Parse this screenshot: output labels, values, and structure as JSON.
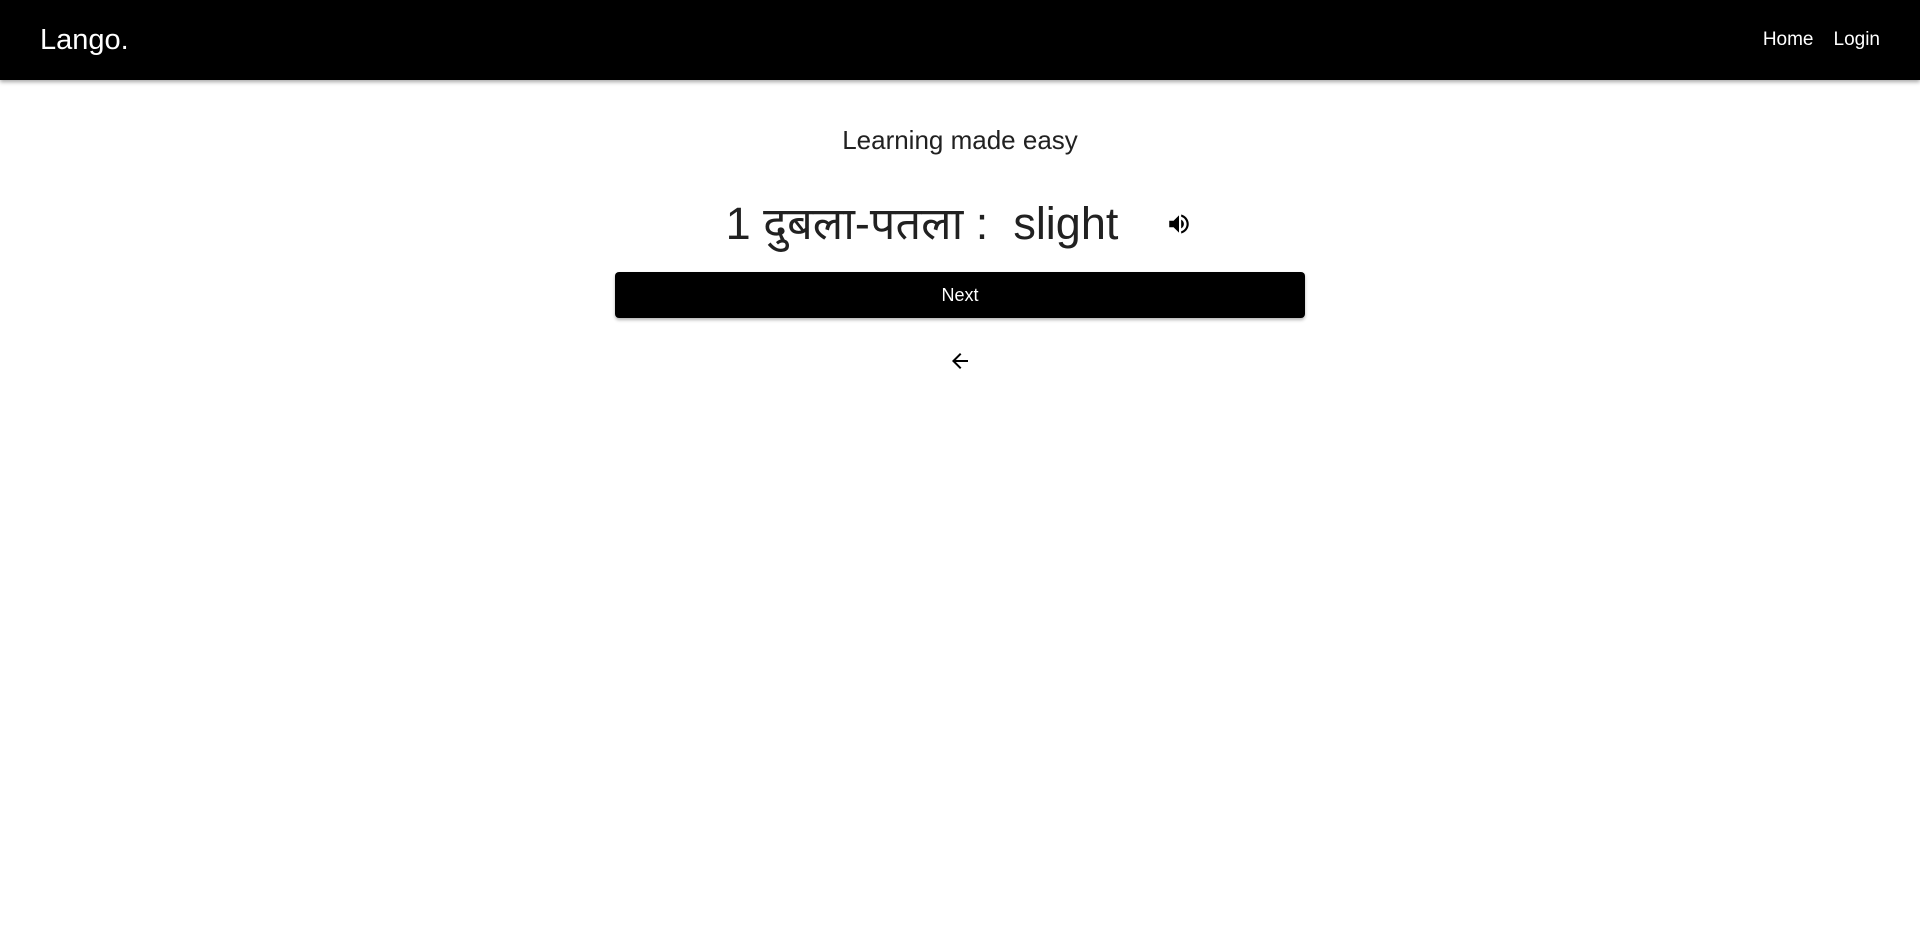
{
  "navbar": {
    "brand": "Lango.",
    "links": [
      {
        "label": "Home"
      },
      {
        "label": "Login"
      }
    ]
  },
  "main": {
    "tagline": "Learning made easy",
    "card": {
      "index": "1",
      "hindi_word": "दुबला-पतला",
      "separator": " :  ",
      "english_word": "slight",
      "speaker_icon": "volume-up-icon"
    },
    "next_button_label": "Next",
    "back_icon": "arrow-left-icon"
  },
  "colors": {
    "navbar_bg": "#000000",
    "button_bg": "#000000",
    "text": "#212121",
    "background": "#ffffff"
  }
}
